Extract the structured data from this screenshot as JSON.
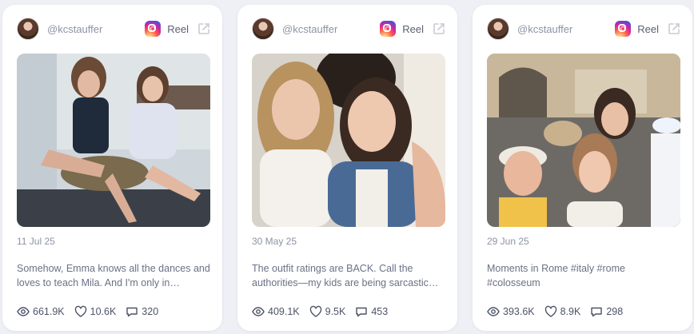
{
  "cards": [
    {
      "username": "@kcstauffer",
      "type_label": "Reel",
      "date": "11 Jul 25",
      "caption": "Somehow, Emma knows all the dances and loves to teach Mila. And I'm only in…",
      "views": "661.9K",
      "likes": "10.6K",
      "comments": "320"
    },
    {
      "username": "@kcstauffer",
      "type_label": "Reel",
      "date": "30 May 25",
      "caption": "The outfit ratings are BACK. Call the authorities—my kids are being sarcastic…",
      "views": "409.1K",
      "likes": "9.5K",
      "comments": "453"
    },
    {
      "username": "@kcstauffer",
      "type_label": "Reel",
      "date": "29 Jun 25",
      "caption": "Moments in Rome #italy #rome #colosseum",
      "views": "393.6K",
      "likes": "8.9K",
      "comments": "298"
    }
  ],
  "icons": {
    "platform": "instagram-icon",
    "external": "external-link-icon",
    "views": "eye-icon",
    "likes": "heart-icon",
    "comments": "comment-icon"
  },
  "colors": {
    "background": "#eef0f5",
    "card": "#ffffff",
    "muted_text": "#8d93a6",
    "body_text": "#6b7185"
  }
}
